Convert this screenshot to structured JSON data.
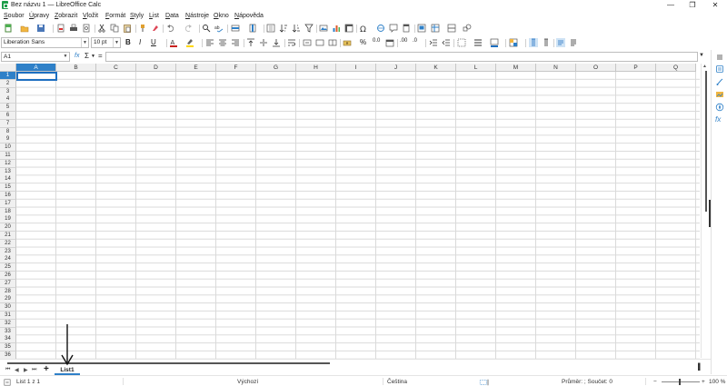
{
  "window": {
    "title": "Bez názvu 1 — LibreOffice Calc",
    "minimize": "—",
    "maximize": "❐",
    "close": "✕"
  },
  "menu": [
    {
      "acc": "S",
      "rest": "oubor"
    },
    {
      "acc": "Ú",
      "rest": "pravy"
    },
    {
      "acc": "Z",
      "rest": "obrazit"
    },
    {
      "acc": "V",
      "rest": "ložit"
    },
    {
      "acc": "F",
      "rest": "ormát"
    },
    {
      "acc": "S",
      "rest": "tyly"
    },
    {
      "acc": "L",
      "rest": "ist"
    },
    {
      "acc": "D",
      "rest": "ata"
    },
    {
      "acc": "N",
      "rest": "ástroje"
    },
    {
      "acc": "O",
      "rest": "kno"
    },
    {
      "acc": "N",
      "rest": "ápověda"
    }
  ],
  "formatting": {
    "font_name": "Liberation Sans",
    "font_size": "10 pt",
    "bold": "B",
    "italic": "I",
    "underline": "U"
  },
  "formula_bar": {
    "cell_ref": "A1",
    "formula": "",
    "sum_symbol": "Σ",
    "equals": "=",
    "function_wizard": "fx"
  },
  "columns": [
    "A",
    "B",
    "C",
    "D",
    "E",
    "F",
    "G",
    "H",
    "I",
    "J",
    "K",
    "L",
    "M",
    "N",
    "O",
    "P",
    "Q"
  ],
  "rows": [
    "1",
    "2",
    "3",
    "4",
    "5",
    "6",
    "7",
    "8",
    "9",
    "10",
    "11",
    "12",
    "13",
    "14",
    "15",
    "16",
    "17",
    "18",
    "19",
    "20",
    "21",
    "22",
    "23",
    "24",
    "25",
    "26",
    "27",
    "28",
    "29",
    "30",
    "31",
    "32",
    "33",
    "34",
    "35",
    "36"
  ],
  "active_cell": {
    "column": "A",
    "row": "1"
  },
  "sheets": [
    {
      "name": "List1",
      "active": true
    }
  ],
  "status": {
    "sheet_position": "List 1 z 1",
    "page_style": "Výchozí",
    "language": "Čeština",
    "selection_summary": "Průměr: ; Součet: 0",
    "zoom": "100 %",
    "zoom_out": "−",
    "zoom_in": "+"
  },
  "colors": {
    "accent": "#2e80c8",
    "cursor": "#1d6fc0",
    "app_icon": "#1e9e4a",
    "font_color": "#c9211e",
    "highlight": "#ffd700",
    "border_color": "#1e6fc0"
  },
  "icons": {
    "toolbar1": [
      "new-document-icon",
      "open-icon",
      "save-icon",
      "export-pdf-icon",
      "print-icon",
      "print-preview-icon",
      "cut-icon",
      "copy-icon",
      "paste-icon",
      "clone-formatting-icon",
      "clear-formatting-icon",
      "undo-icon",
      "redo-icon",
      "find-replace-icon",
      "spellcheck-icon",
      "row-icon",
      "column-icon",
      "sort-icon",
      "sort-ascending-icon",
      "sort-descending-icon",
      "autofilter-icon",
      "image-icon",
      "chart-icon",
      "pivot-table-icon",
      "special-character-icon",
      "hyperlink-icon",
      "comment-icon",
      "header-footer-icon",
      "define-print-area-icon",
      "freeze-icon",
      "split-window-icon",
      "show-draw-functions-icon"
    ],
    "sidebar": [
      "sidebar-menu-icon",
      "properties-icon",
      "styles-icon",
      "gallery-icon",
      "navigator-icon",
      "functions-icon"
    ]
  }
}
